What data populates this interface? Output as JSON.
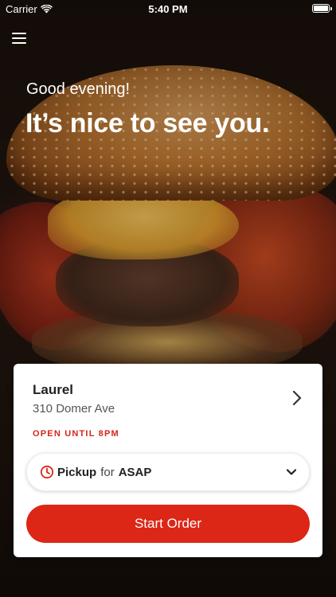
{
  "status_bar": {
    "carrier": "Carrier",
    "time": "5:40 PM"
  },
  "header": {
    "menu_icon": "hamburger-menu-icon",
    "greeting": "Good evening!",
    "headline": "It’s nice to see you."
  },
  "store_card": {
    "name": "Laurel",
    "address": "310 Domer Ave",
    "hours": "OPEN UNTIL 8PM",
    "chevron_icon": "chevron-right-icon",
    "pickup": {
      "clock_icon": "clock-icon",
      "mode": "Pickup",
      "connector": "for",
      "time": "ASAP",
      "dropdown_icon": "chevron-down-icon"
    },
    "start_button_label": "Start Order"
  },
  "colors": {
    "accent": "#dc2716",
    "hours_red": "#d4271c",
    "card_bg": "#ffffff"
  }
}
